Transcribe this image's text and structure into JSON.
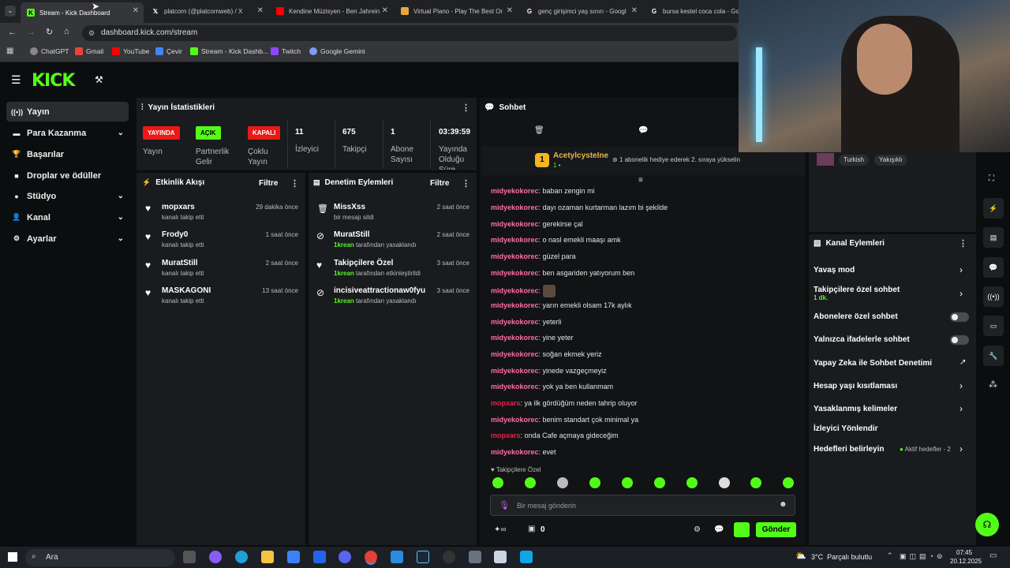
{
  "browser": {
    "tabs": [
      {
        "title": "Stream - Kick Dashboard",
        "icon": "kick-icon"
      },
      {
        "title": "platcorn (@platcornweb) / X",
        "icon": "x-icon"
      },
      {
        "title": "Kendine Müzisyen - Ben Jahrein",
        "icon": "youtube-icon"
      },
      {
        "title": "Virtual Piano - Play The Best Or",
        "icon": "piano-icon"
      },
      {
        "title": "genç girişimci yaş sınırı - Googl",
        "icon": "google-icon"
      },
      {
        "title": "bursa kestel coca cola - Goo",
        "icon": "google-icon"
      }
    ],
    "url": "dashboard.kick.com/stream",
    "bookmarks": [
      "ChatGPT",
      "Gmail",
      "YouTube",
      "Çevir",
      "Stream - Kick Dashb...",
      "Twitch",
      "Google Gemini"
    ]
  },
  "sidebar": {
    "items": [
      {
        "label": "Yayın",
        "active": true
      },
      {
        "label": "Para Kazanma",
        "chevron": true
      },
      {
        "label": "Başarılar"
      },
      {
        "label": "Droplar ve ödüller"
      },
      {
        "label": "Stüdyo",
        "chevron": true
      },
      {
        "label": "Kanal",
        "chevron": true
      },
      {
        "label": "Ayarlar",
        "chevron": true
      }
    ]
  },
  "stats": {
    "title": "Yayın İstatistikleri",
    "badges": [
      {
        "badge": "YAYINDA",
        "label": "Yayın",
        "color": "#e91916"
      },
      {
        "badge": "AÇIK",
        "label": "Partnerlik Gelir",
        "color": "#53fc18"
      },
      {
        "badge": "KAPALI",
        "label": "Çoklu Yayın",
        "color": "#e91916"
      }
    ],
    "metrics": [
      {
        "value": "11",
        "label": "İzleyici"
      },
      {
        "value": "675",
        "label": "Takipçi"
      },
      {
        "value": "1",
        "label": "Abone Sayısı"
      },
      {
        "value": "03:39:59",
        "label": "Yayında Olduğu Süre"
      }
    ]
  },
  "activity": {
    "title": "Etkinlik Akışı",
    "filter": "Filtre",
    "items": [
      {
        "name": "mopxars",
        "sub": "kanalı takip etti",
        "time": "29 dakika önce"
      },
      {
        "name": "Frody0",
        "sub": "kanalı takip etti",
        "time": "1 saat önce"
      },
      {
        "name": "MuratStill",
        "sub": "kanalı takip etti",
        "time": "2 saat önce"
      },
      {
        "name": "MASKAGONI",
        "sub": "kanalı takip etti",
        "time": "13 saat önce"
      }
    ]
  },
  "moderation": {
    "title": "Denetim Eylemleri",
    "filter": "Filtre",
    "items": [
      {
        "name": "MissXss",
        "actor": "",
        "sub": "bir mesajı sildi",
        "time": "2 saat önce"
      },
      {
        "name": "MuratStill",
        "actor": "1krean",
        "sub": "tarafından yasaklandı",
        "time": "2 saat önce"
      },
      {
        "name": "Takipçilere Özel",
        "actor": "1krean",
        "sub": "tarafından etkinleştirildi",
        "time": "3 saat önce"
      },
      {
        "name": "incisiveattractionaw0fyu",
        "actor": "1krean",
        "sub": "tarafından yasaklandı",
        "time": "3 saat önce"
      }
    ]
  },
  "chat": {
    "title": "Sohbet",
    "pinned_user": "AcetylcysteIne",
    "pinned_rank": "1",
    "pinned_text": "1 abonelik hediye ederek 2. sıraya yükselin",
    "messages": [
      {
        "user": "midyekokorec",
        "text": "baban zengin mi"
      },
      {
        "user": "midyekokorec",
        "text": "dayı ozaman kurtarman lazım bi şekilde"
      },
      {
        "user": "midyekokorec",
        "text": "gerekirse çal"
      },
      {
        "user": "midyekokorec",
        "text": "o nasl emekli maaşı amk"
      },
      {
        "user": "midyekokorec",
        "text": "güzel para"
      },
      {
        "user": "midyekokorec",
        "text": "ben asgariden yatıyorum ben"
      },
      {
        "user": "midyekokorec",
        "text": ""
      },
      {
        "user": "midyekokorec",
        "text": "yarın emekli olsam 17k aylık"
      },
      {
        "user": "midyekokorec",
        "text": "yeterli"
      },
      {
        "user": "midyekokorec",
        "text": "yine yeter"
      },
      {
        "user": "midyekokorec",
        "text": "soğan ekmek yeriz"
      },
      {
        "user": "midyekokorec",
        "text": "yinede vazgeçmeyiz"
      },
      {
        "user": "midyekokorec",
        "text": "yok ya ben kullanmam"
      },
      {
        "user": "mopxars",
        "text": "ya ilk gördüğüm neden tahrip oluyor"
      },
      {
        "user": "midyekokorec",
        "text": "benim standart çok minimal ya"
      },
      {
        "user": "mopxars",
        "text": "onda Cafe açmaya gideceğim"
      },
      {
        "user": "midyekokorec",
        "text": "evet"
      }
    ],
    "mode_label": "Takipçilere Özel",
    "input_placeholder": "Bir mesaj gönderin",
    "send_label": "Gönder",
    "points": "0"
  },
  "stream_info": {
    "tags": [
      "Turkish",
      "Yakışıklı"
    ]
  },
  "channel_actions": {
    "title": "Kanal Eylemleri",
    "items": [
      {
        "label": "Yavaş mod",
        "type": "chevron"
      },
      {
        "label": "Takipçilere özel sohbet",
        "sub": "1 dk.",
        "type": "chevron"
      },
      {
        "label": "Abonelere özel sohbet",
        "type": "toggle"
      },
      {
        "label": "Yalnızca ifadelerle sohbet",
        "type": "toggle"
      },
      {
        "label": "Yapay Zeka ile Sohbet Denetimi",
        "type": "external"
      },
      {
        "label": "Hesap yaşı kısıtlaması",
        "type": "chevron"
      },
      {
        "label": "Yasaklanmış kelimeler",
        "type": "chevron"
      },
      {
        "label": "İzleyici Yönlendir",
        "type": "none"
      },
      {
        "label": "Hedefleri belirleyin",
        "type": "chevron",
        "extra": "Aktif hedefler - 2"
      }
    ]
  },
  "taskbar": {
    "search": "Ara",
    "weather": "3°C  Parçalı bulutlu",
    "time": "07:45",
    "date": "20.12.2025"
  },
  "colors": {
    "kick_green": "#53fc18",
    "live_red": "#e91916",
    "chat_user": "#ff6fa0"
  }
}
